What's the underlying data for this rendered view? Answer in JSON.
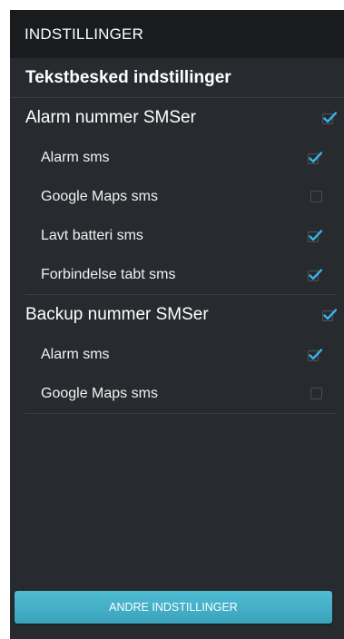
{
  "app_bar": {
    "title": "INDSTILLINGER"
  },
  "section": {
    "title": "Tekstbesked indstillinger"
  },
  "groups": [
    {
      "label": "Alarm nummer SMSer",
      "checked": true,
      "items": [
        {
          "label": "Alarm sms",
          "checked": true
        },
        {
          "label": "Google Maps sms",
          "checked": false
        },
        {
          "label": "Lavt batteri sms",
          "checked": true
        },
        {
          "label": "Forbindelse tabt sms",
          "checked": true
        }
      ]
    },
    {
      "label": "Backup nummer SMSer",
      "checked": true,
      "items": [
        {
          "label": "Alarm sms",
          "checked": true
        },
        {
          "label": "Google Maps sms",
          "checked": false
        }
      ]
    }
  ],
  "footer": {
    "button_label": "ANDRE INDSTILLINGER"
  },
  "colors": {
    "accent": "#33b5e5",
    "background": "#272a2f",
    "app_bar": "#1a1b1e",
    "button": "#45b0c8"
  }
}
